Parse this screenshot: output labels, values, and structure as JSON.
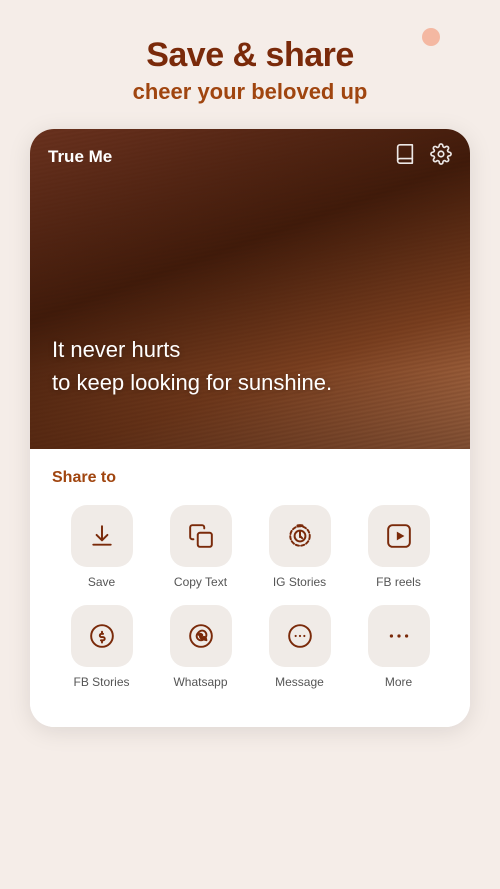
{
  "header": {
    "title": "Save & share",
    "subtitle": "cheer your beloved up"
  },
  "app": {
    "name": "True Me"
  },
  "quote": {
    "line1": "It never hurts",
    "line2": "to keep looking for sunshine."
  },
  "share": {
    "title": "Share to",
    "row1": [
      {
        "id": "save",
        "label": "Save",
        "icon": "save"
      },
      {
        "id": "copy-text",
        "label": "Copy Text",
        "icon": "copy"
      },
      {
        "id": "ig-stories",
        "label": "IG Stories",
        "icon": "ig"
      },
      {
        "id": "fb-reels",
        "label": "FB reels",
        "icon": "fb-play"
      }
    ],
    "row2": [
      {
        "id": "fb-stories",
        "label": "FB Stories",
        "icon": "facebook"
      },
      {
        "id": "whatsapp",
        "label": "Whatsapp",
        "icon": "whatsapp"
      },
      {
        "id": "message",
        "label": "Message",
        "icon": "message"
      },
      {
        "id": "more",
        "label": "More",
        "icon": "more"
      }
    ]
  }
}
